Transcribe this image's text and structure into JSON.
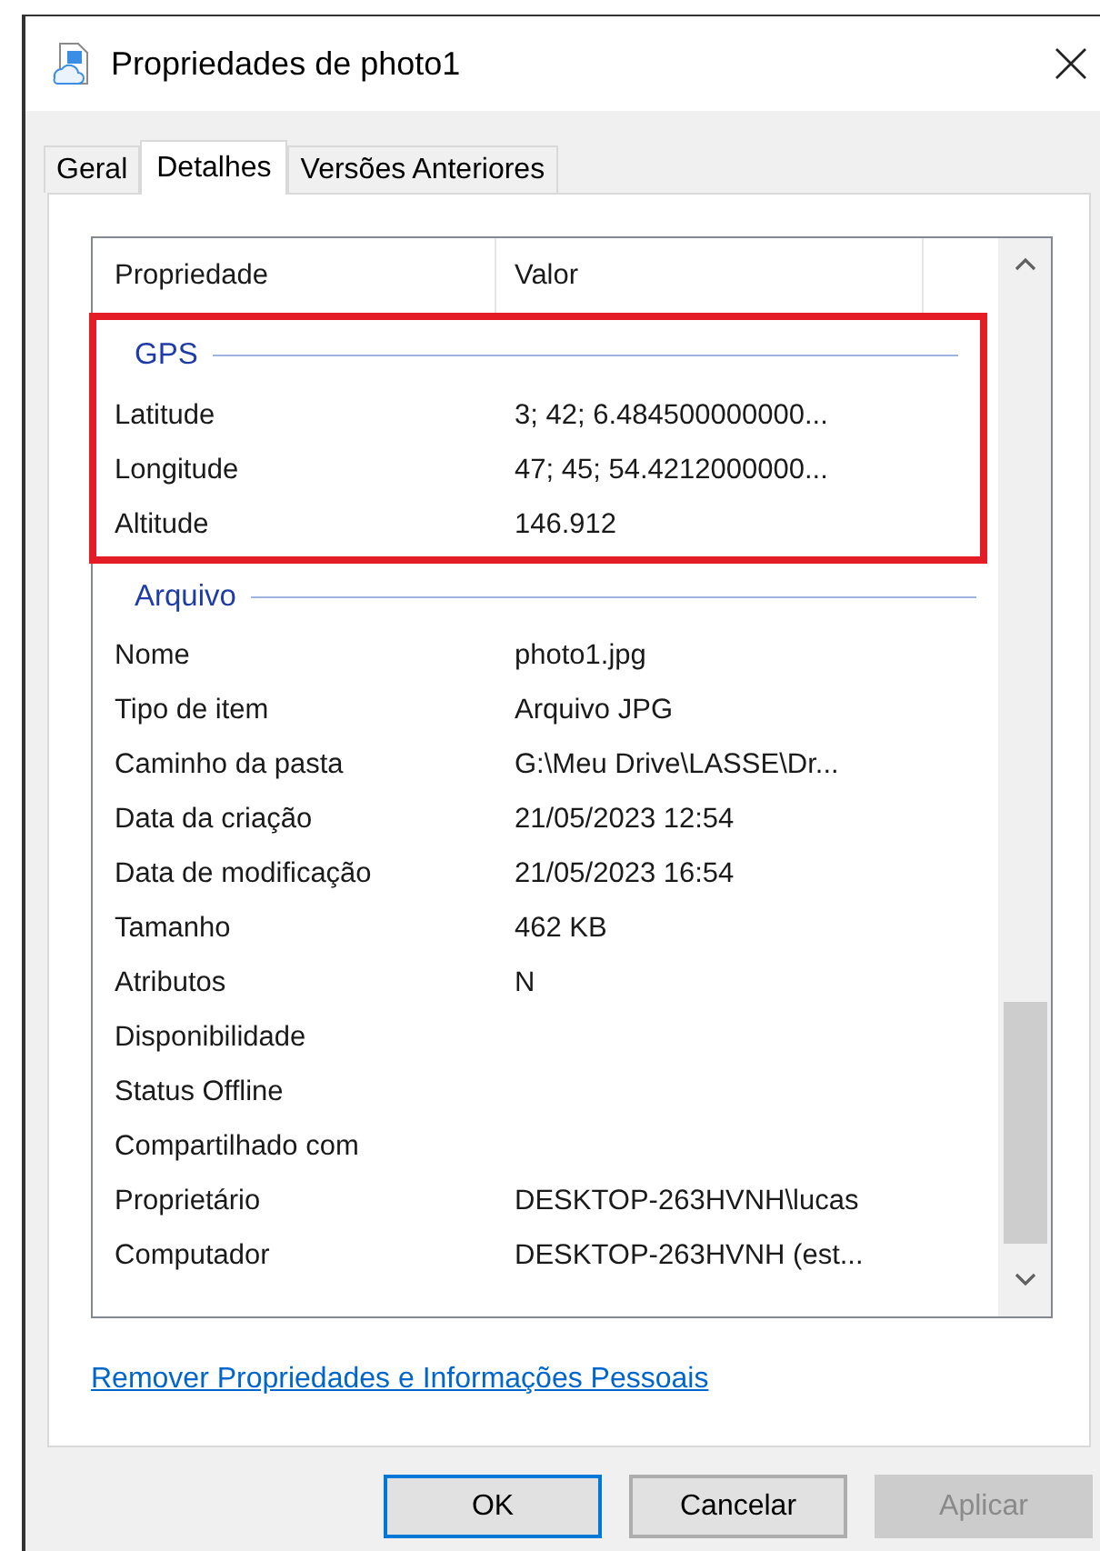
{
  "window": {
    "title": "Propriedades de photo1"
  },
  "tabs": [
    {
      "label": "Geral",
      "selected": false
    },
    {
      "label": "Detalhes",
      "selected": true
    },
    {
      "label": "Versões Anteriores",
      "selected": false
    }
  ],
  "table": {
    "columns": [
      "Propriedade",
      "Valor"
    ],
    "groups": [
      {
        "title": "GPS",
        "highlighted": true,
        "rows": [
          {
            "property": "Latitude",
            "value": "3; 42; 6.484500000000..."
          },
          {
            "property": "Longitude",
            "value": "47; 45; 54.4212000000..."
          },
          {
            "property": "Altitude",
            "value": "146.912"
          }
        ]
      },
      {
        "title": "Arquivo",
        "highlighted": false,
        "rows": [
          {
            "property": "Nome",
            "value": "photo1.jpg"
          },
          {
            "property": "Tipo de item",
            "value": "Arquivo JPG"
          },
          {
            "property": "Caminho da pasta",
            "value": "G:\\Meu Drive\\LASSE\\Dr..."
          },
          {
            "property": "Data da criação",
            "value": "21/05/2023 12:54"
          },
          {
            "property": "Data de modificação",
            "value": "21/05/2023 16:54"
          },
          {
            "property": "Tamanho",
            "value": "462 KB"
          },
          {
            "property": "Atributos",
            "value": "N"
          },
          {
            "property": "Disponibilidade"
          },
          {
            "property": "Status Offline"
          },
          {
            "property": "Compartilhado com"
          },
          {
            "property": "Proprietário",
            "value": "DESKTOP-263HVNH\\lucas"
          },
          {
            "property": "Computador",
            "value": "DESKTOP-263HVNH (est..."
          }
        ]
      }
    ]
  },
  "link": "Remover Propriedades e Informações Pessoais",
  "buttons": [
    {
      "label": "OK",
      "default": true,
      "disabled": false
    },
    {
      "label": "Cancelar",
      "default": false,
      "disabled": false
    },
    {
      "label": "Aplicar",
      "default": false,
      "disabled": true
    }
  ]
}
